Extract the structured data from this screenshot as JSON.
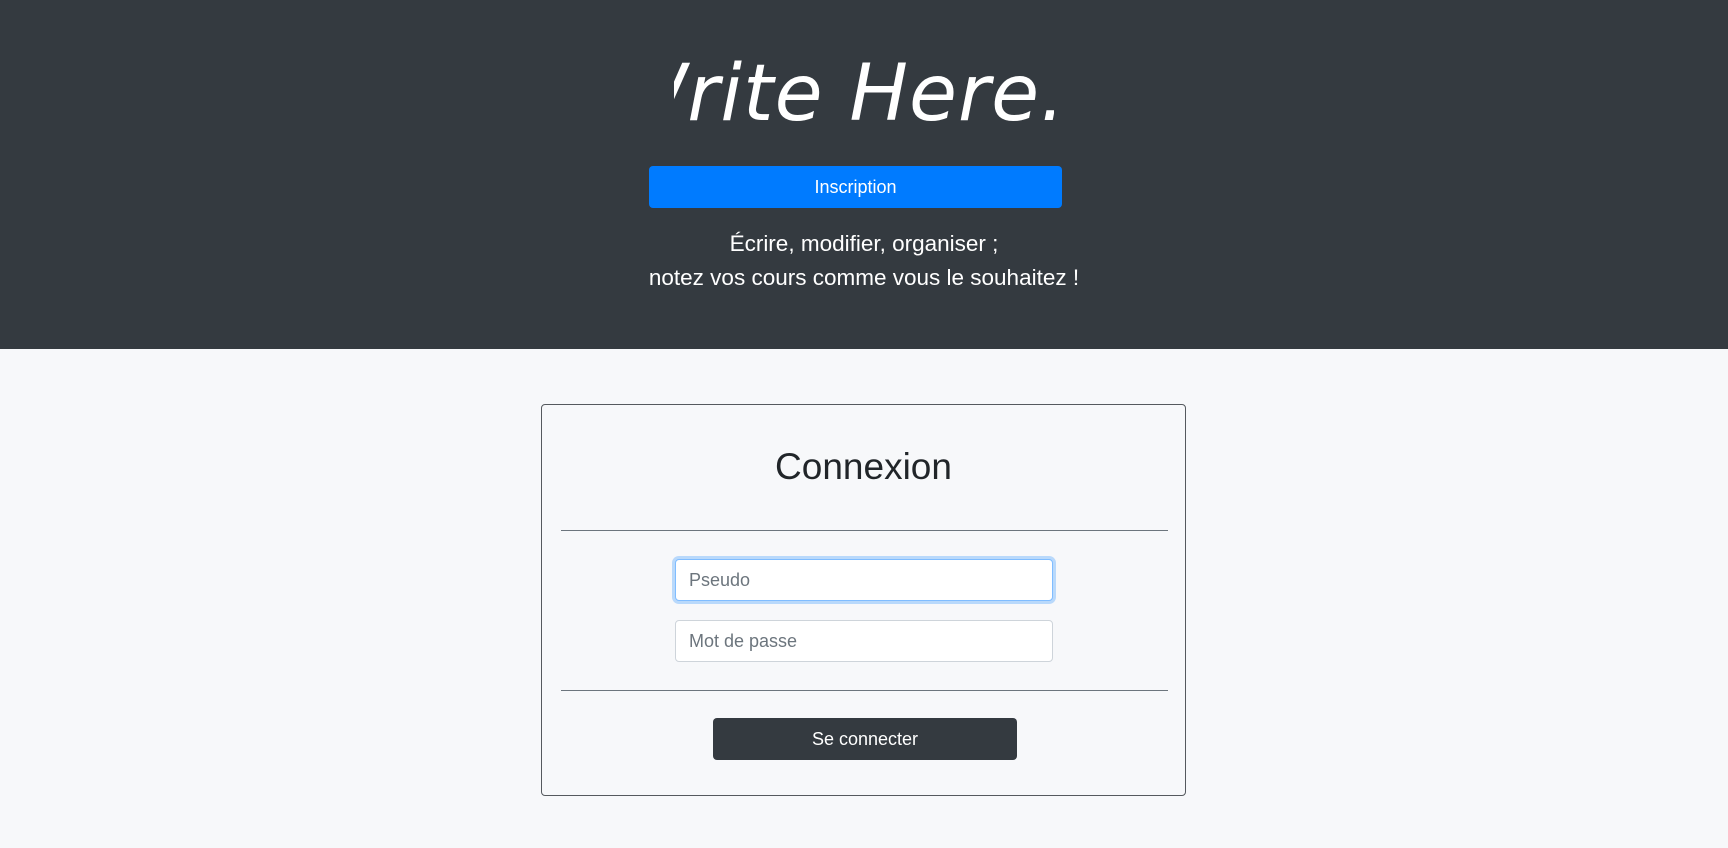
{
  "header": {
    "logo_text": "Write Here...",
    "signup_label": "Inscription",
    "tagline_line1": "Écrire, modifier, organiser ;",
    "tagline_line2": "notez vos cours comme vous le souhaitez !"
  },
  "login": {
    "title": "Connexion",
    "username_placeholder": "Pseudo",
    "username_value": "",
    "password_placeholder": "Mot de passe",
    "password_value": "",
    "submit_label": "Se connecter"
  },
  "colors": {
    "hero_background": "#343a40",
    "page_background": "#f7f8fa",
    "primary": "#007bff",
    "dark_button": "#343a40",
    "focus_ring": "#80bdff"
  }
}
